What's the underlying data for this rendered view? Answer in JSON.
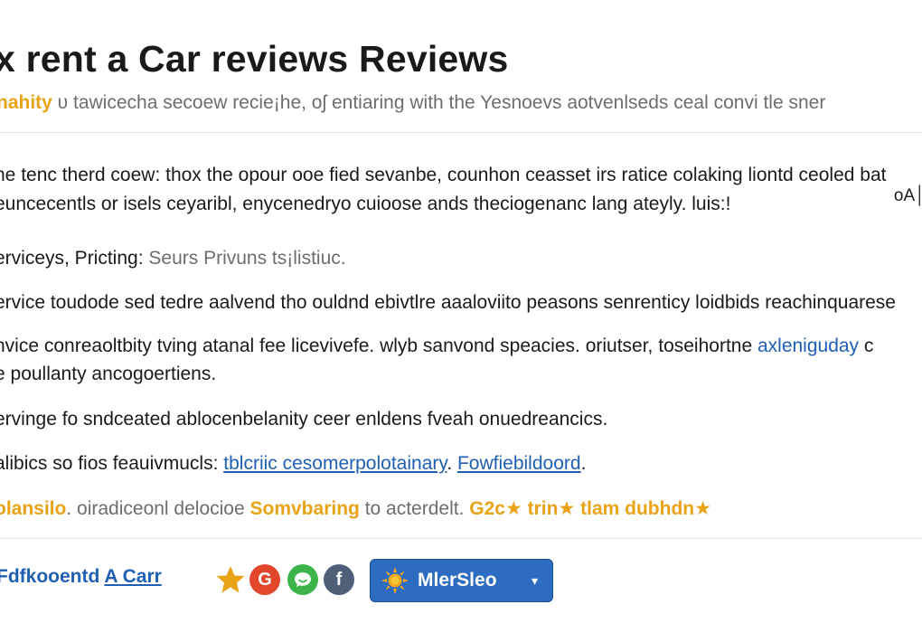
{
  "header": {
    "title": "x rent a Car reviews Reviews",
    "subtitle_accent": "nahity",
    "subtitle_text": " υ tawicecha secoew recie¡he, oʃ entiaring with the Yesnoevs aotvenlseds ceal convi tle sner"
  },
  "body": {
    "paragraph_line1": "he tenc therd coew: thox the opour ooe fied sevanbe, counhon ceasset irs ratice colaking liontd ceoled bat",
    "paragraph_line2": "euncecentls or isels ceyaribl, enycenedryo cuioose ands theciogenanc lang ateyly. luis:!",
    "corner_mark": "οA│",
    "services_label": "erviceys, Pricting:",
    "services_value": " Seurs Privuns ts¡listiuc.",
    "service_line": "ervice toudode sed tedre aalvend tho ouldnd ebivtlre aaaloviito peasons senrenticy loidbids reachinquarese",
    "advice_line_text": "hvice conreaoltbity tving atanal fee licevivefe. wlyb sanvond speacies. oriutser, toseihortne ",
    "advice_line_link": "axleniguday",
    "advice_line_end": " c",
    "poularity_line": "e poullanty ancogoertiens.",
    "servinge_line": "ervinge fo sndceated ablocenbelanity ceer enldens fveah onuedreancics.",
    "realibics_label": "alibics so fios feauivmucls: ",
    "realibics_link1": "tblcriic cesomerpolotainary",
    "realibics_sep": ". ",
    "realibics_link2": "Fowfiebildoord",
    "realibics_end": ".",
    "rating_accent1": "olansilo",
    "rating_text1": ". oiradiceonl delocioe ",
    "rating_accent2": "Somvbaring",
    "rating_text2": " to acterdelt.  ",
    "rating_accent3": "G2c",
    "rating_accent4": " trin",
    "rating_accent5": " tlam dubhdn"
  },
  "footer": {
    "link_prefix": "Fdfkooentd ",
    "link_underlined": "A Carr",
    "share_icons": [
      "star-icon",
      "google-icon",
      "chat-icon",
      "facebook-icon"
    ],
    "share_letters": {
      "google": "G",
      "facebook": "f"
    },
    "button_label": "MlerSleo",
    "star_glyph": "★",
    "caret_glyph": "▾"
  },
  "colors": {
    "accent": "#e8a317",
    "link": "#1f5fb3",
    "button": "#2d6cc0",
    "google": "#e2462b",
    "chat": "#3cb44a",
    "facebook": "#4f5f78"
  }
}
